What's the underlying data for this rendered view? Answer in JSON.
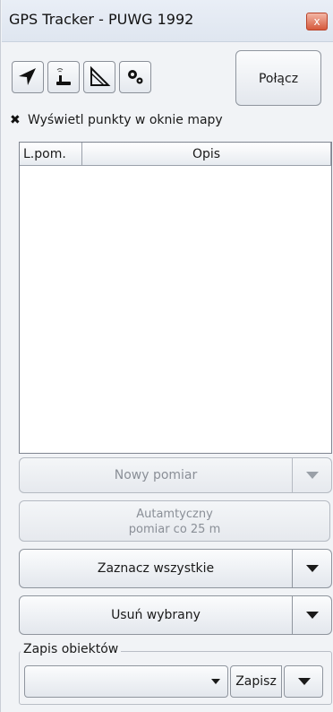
{
  "window": {
    "title": "GPS Tracker - PUWG 1992",
    "close_glyph": "x"
  },
  "toolbar": {
    "icons": [
      "navigation-arrow-icon",
      "gps-receiver-icon",
      "angle-measure-icon",
      "settings-gears-icon"
    ],
    "connect_label": "Połącz"
  },
  "display_points": {
    "checked": true,
    "label": "Wyświetl punkty w oknie mapy"
  },
  "table": {
    "columns": [
      "L.pom.",
      "Opis"
    ],
    "rows": []
  },
  "actions": {
    "new_measurement": "Nowy pomiar",
    "auto_measurement_line1": "Autamtyczny",
    "auto_measurement_line2": "pomiar co 25 m",
    "select_all": "Zaznacz wszystkie",
    "delete_selected": "Usuń wybrany"
  },
  "save_objects": {
    "group_label": "Zapis obiektów",
    "combo_value": "",
    "save_label": "Zapisz"
  }
}
